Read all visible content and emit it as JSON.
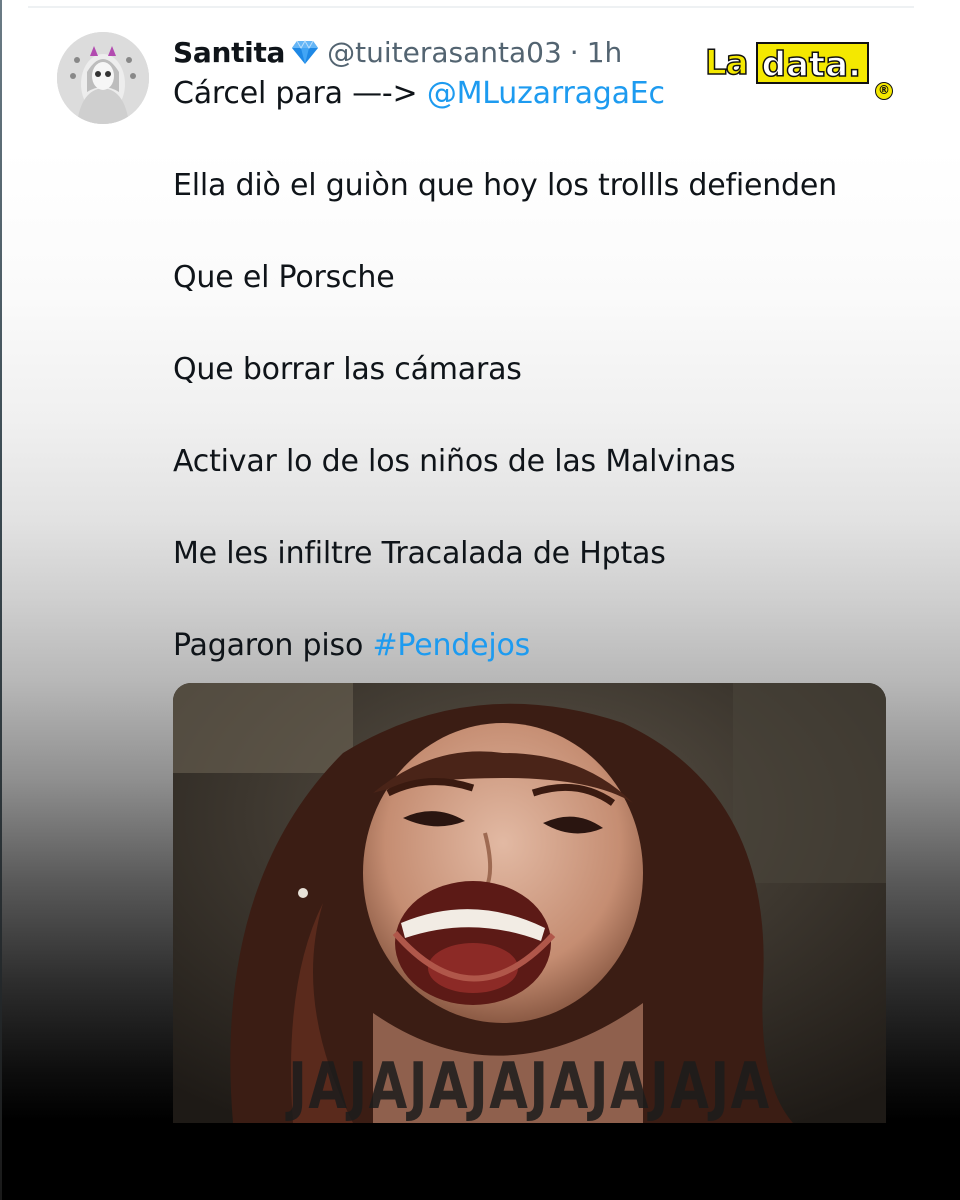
{
  "tweet": {
    "display_name": "Santita",
    "verified_badge_icon": "diamond-icon",
    "handle": "@tuiterasanta03",
    "separator": "·",
    "time": "1h",
    "first_line_prefix": "Cárcel para —->",
    "mention": "@MLuzarragaEc",
    "lines": [
      "Ella diò el guiòn que hoy los trollls defienden",
      "Que el Porsche",
      "Que borrar las cámaras",
      "Activar lo de los niños de las Malvinas",
      "Me les infiltre Tracalada de Hptas"
    ],
    "last_line_prefix": "Pagaron piso",
    "hashtag": "#Pendejos"
  },
  "media": {
    "caption": "JAJAJAJAJAJAJAJA",
    "description_icon": "laughing-woman-image"
  },
  "watermark": {
    "part1": "La",
    "part2": "data.",
    "mark": "®"
  },
  "colors": {
    "text": "#0f1419",
    "secondary": "#536471",
    "link": "#1d9bf0",
    "logo_yellow": "#f4e800"
  }
}
